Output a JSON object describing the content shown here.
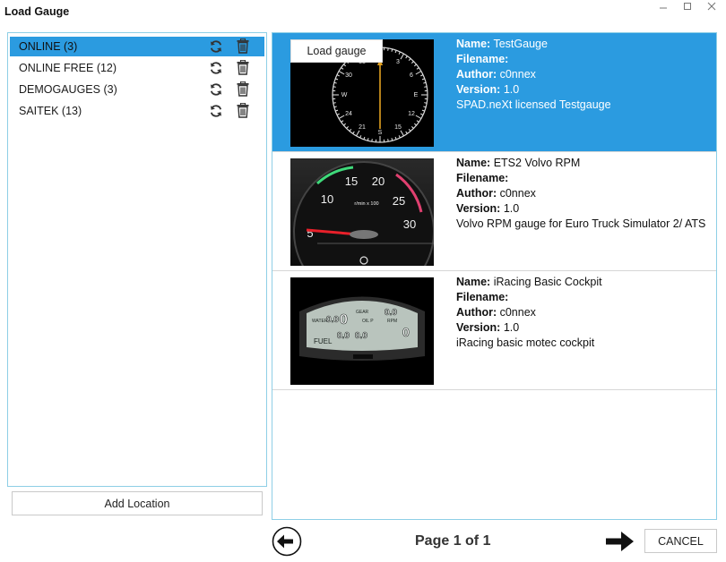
{
  "window": {
    "title": "Load Gauge",
    "minimize_icon": "minimize-icon",
    "maximize_icon": "maximize-icon",
    "close_icon": "close-icon"
  },
  "locations": {
    "selected_index": 0,
    "items": [
      {
        "label": "ONLINE (3)"
      },
      {
        "label": "ONLINE FREE (12)"
      },
      {
        "label": "DEMOGAUGES (3)"
      },
      {
        "label": "SAITEK (13)"
      }
    ],
    "refresh_icon": "refresh-icon",
    "trash_icon": "trash-icon",
    "add_label": "Add Location"
  },
  "gauges": {
    "selected_index": 0,
    "load_button_label": "Load gauge",
    "field_labels": {
      "name": "Name:",
      "filename": "Filename:",
      "author": "Author:",
      "version": "Version:"
    },
    "items": [
      {
        "name": "TestGauge",
        "filename": "",
        "author": "c0nnex",
        "version": "1.0",
        "description": "SPAD.neXt licensed Testgauge"
      },
      {
        "name": "ETS2 Volvo RPM",
        "filename": "",
        "author": "c0nnex",
        "version": "1.0",
        "description": "Volvo RPM gauge for Euro Truck Simulator 2/ ATS"
      },
      {
        "name": "iRacing Basic Cockpit",
        "filename": "",
        "author": "c0nnex",
        "version": "1.0",
        "description": "iRacing basic motec cockpit"
      }
    ],
    "thumbnails": {
      "compass_labels": [
        "N",
        "3",
        "6",
        "E",
        "12",
        "15",
        "S",
        "21",
        "24",
        "W",
        "30",
        "33"
      ],
      "rpm_labels": [
        "5",
        "10",
        "15",
        "20",
        "25",
        "30"
      ],
      "rpm_unit": "r/min x 100",
      "dash_labels": {
        "water": "WATER",
        "oil_p": "OIL P",
        "rpm": "RPM",
        "gear": "GEAR",
        "fuel": "FUEL",
        "digit": "0",
        "digit2": "0.0"
      }
    }
  },
  "footer": {
    "page_label": "Page 1 of 1",
    "prev_icon": "arrow-left-icon",
    "next_icon": "arrow-right-icon",
    "cancel_label": "CANCEL"
  },
  "colors": {
    "accent": "#2b9be0",
    "panel_border": "#8ecfe6"
  }
}
